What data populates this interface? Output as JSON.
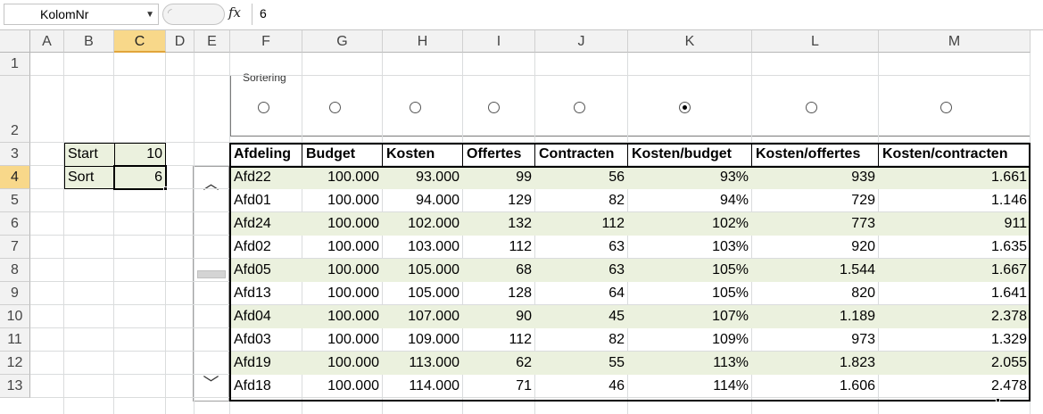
{
  "formula_bar": {
    "name_box": "KolomNr",
    "fx_label": "fx",
    "formula_value": "6"
  },
  "columns": [
    "A",
    "B",
    "C",
    "D",
    "E",
    "F",
    "G",
    "H",
    "I",
    "J",
    "K",
    "L",
    "M"
  ],
  "rows": [
    "1",
    "2",
    "3",
    "4",
    "5",
    "6",
    "7",
    "8",
    "9",
    "10",
    "11",
    "12",
    "13"
  ],
  "selected_column": "C",
  "selected_row": "4",
  "params": {
    "start_label": "Start",
    "start_value": "10",
    "sort_label": "Sort",
    "sort_value": "6"
  },
  "option_group": {
    "title": "Sortering",
    "selected_index": 5,
    "option_count": 8
  },
  "scrollbar": {
    "up_icon": "chevron-up-icon",
    "down_icon": "chevron-down-icon"
  },
  "table": {
    "headers": [
      "Afdeling",
      "Budget",
      "Kosten",
      "Offertes",
      "Contracten",
      "Kosten/budget",
      "Kosten/offertes",
      "Kosten/contracten"
    ],
    "rows": [
      [
        "Afd22",
        "100.000",
        "93.000",
        "99",
        "56",
        "93%",
        "939",
        "1.661"
      ],
      [
        "Afd01",
        "100.000",
        "94.000",
        "129",
        "82",
        "94%",
        "729",
        "1.146"
      ],
      [
        "Afd24",
        "100.000",
        "102.000",
        "132",
        "112",
        "102%",
        "773",
        "911"
      ],
      [
        "Afd02",
        "100.000",
        "103.000",
        "112",
        "63",
        "103%",
        "920",
        "1.635"
      ],
      [
        "Afd05",
        "100.000",
        "105.000",
        "68",
        "63",
        "105%",
        "1.544",
        "1.667"
      ],
      [
        "Afd13",
        "100.000",
        "105.000",
        "128",
        "64",
        "105%",
        "820",
        "1.641"
      ],
      [
        "Afd04",
        "100.000",
        "107.000",
        "90",
        "45",
        "107%",
        "1.189",
        "2.378"
      ],
      [
        "Afd03",
        "100.000",
        "109.000",
        "112",
        "82",
        "109%",
        "973",
        "1.329"
      ],
      [
        "Afd19",
        "100.000",
        "113.000",
        "62",
        "55",
        "113%",
        "1.823",
        "2.055"
      ],
      [
        "Afd18",
        "100.000",
        "114.000",
        "71",
        "46",
        "114%",
        "1.606",
        "2.478"
      ]
    ]
  },
  "colors": {
    "band": "#ebf1de",
    "header_selected": "#f8d88a"
  }
}
